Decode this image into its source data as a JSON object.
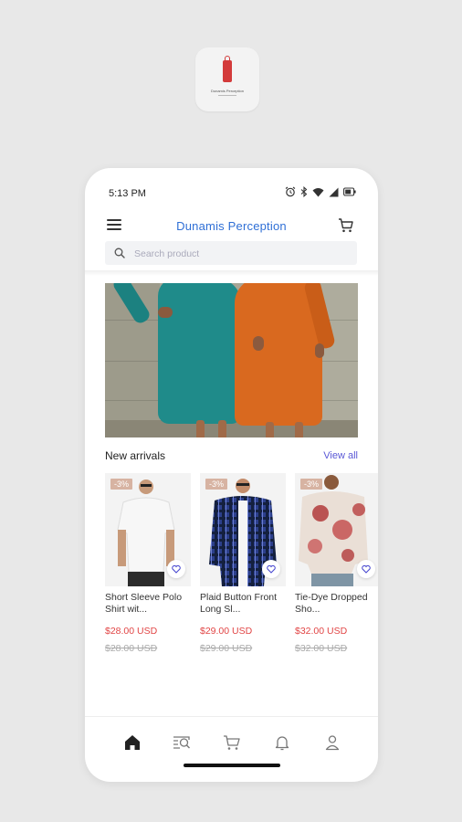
{
  "logo": {
    "text": "Dunamis Perception"
  },
  "status_bar": {
    "time": "5:13 PM"
  },
  "header": {
    "title": "Dunamis Perception"
  },
  "search": {
    "placeholder": "Search product",
    "value": ""
  },
  "section": {
    "title": "New arrivals",
    "view_all": "View all"
  },
  "products": [
    {
      "name": "Short Sleeve Polo Shirt wit...",
      "price": "$28.00 USD",
      "old_price": "$28.00 USD",
      "discount": "-3%"
    },
    {
      "name": "Plaid Button Front Long Sl...",
      "price": "$29.00 USD",
      "old_price": "$29.00 USD",
      "discount": "-3%"
    },
    {
      "name": "Tie-Dye Dropped Sho...",
      "price": "$32.00 USD",
      "old_price": "$32.00 USD",
      "discount": "-3%"
    }
  ],
  "bottom_nav": [
    {
      "icon": "home-icon",
      "active": true
    },
    {
      "icon": "search-list-icon",
      "active": false
    },
    {
      "icon": "cart-icon",
      "active": false
    },
    {
      "icon": "bell-icon",
      "active": false
    },
    {
      "icon": "user-icon",
      "active": false
    }
  ],
  "colors": {
    "accent": "#2f6fd6",
    "price": "#e14545",
    "link": "#5a58d6",
    "badge": "#d7b3a2"
  }
}
